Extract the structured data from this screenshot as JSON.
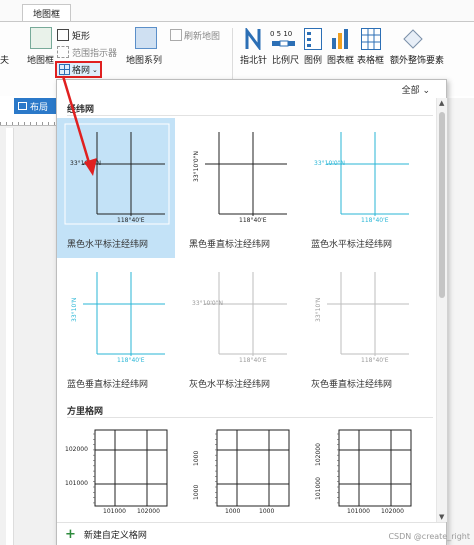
{
  "ribbon": {
    "tab_label": "地图框",
    "partial_left_label": "夫",
    "map_frame": "地图框",
    "rectangle": "矩形",
    "extent_indicator": "范围指示器",
    "grid": "格网",
    "map_series": "地图系列",
    "refresh_map": "刷新地图",
    "north_arrow": "指北针",
    "scale_bar": "比例尺",
    "scale_bar_sample": "0  5  10",
    "legend": "图例",
    "chart_frame": "图表框",
    "table_frame": "表格框",
    "extra_element": "额外整饰要素"
  },
  "layout_tab": "布局",
  "gallery": {
    "filter": "全部",
    "sections": {
      "graticule": "经纬网",
      "grid": "方里格网"
    },
    "graticule_items": [
      {
        "label": "黑色水平标注经纬网",
        "lat": "33°10'0\"N",
        "lon": "118°40'E",
        "color": "#222222",
        "tick": "#222222",
        "vertical": false,
        "selected": true
      },
      {
        "label": "黑色垂直标注经纬网",
        "lat": "33°10'0\"N",
        "lon": "118°40'E",
        "color": "#222222",
        "tick": "#222222",
        "vertical": true,
        "selected": false
      },
      {
        "label": "蓝色水平标注经纬网",
        "lat": "33°10'0\"N",
        "lon": "118°40'E",
        "color": "#29b6d6",
        "tick": "#29b6d6",
        "vertical": false,
        "selected": false
      },
      {
        "label": "蓝色垂直标注经纬网",
        "lat": "33°10'N",
        "lon": "118°40'E",
        "color": "#29b6d6",
        "tick": "#29b6d6",
        "vertical": true,
        "selected": false
      },
      {
        "label": "灰色水平标注经纬网",
        "lat": "33°10'0\"N",
        "lon": "118°40'E",
        "color": "#bdbdbd",
        "tick": "#9a9a9a",
        "vertical": false,
        "selected": false
      },
      {
        "label": "灰色垂直标注经纬网",
        "lat": "33°10'N",
        "lon": "118°40'E",
        "color": "#bdbdbd",
        "tick": "#9a9a9a",
        "vertical": true,
        "selected": false
      }
    ],
    "grid_items": [
      {
        "y1": "102000",
        "y2": "101000",
        "x1": "101000",
        "x2": "102000",
        "vertical": false
      },
      {
        "y1": "1000",
        "y2": "1000",
        "x1": "1000",
        "x2": "1000",
        "vertical": true
      },
      {
        "y1": "102000",
        "y2": "101000",
        "x1": "101000",
        "x2": "102000",
        "vertical": true
      }
    ],
    "new_custom": "新建自定义格网"
  },
  "watermark": "CSDN @create_right",
  "colors": {
    "accent": "#2b79c9",
    "highlight": "#c3e2f7",
    "callout": "#e02020"
  }
}
